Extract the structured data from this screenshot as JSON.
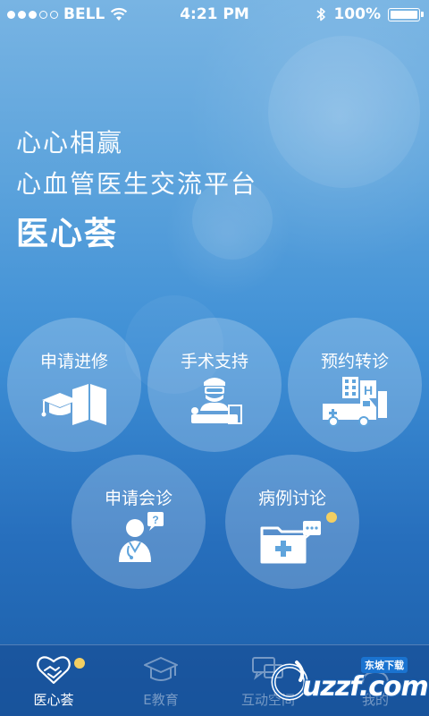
{
  "status_bar": {
    "carrier": "BELL",
    "time": "4:21 PM",
    "battery": "100%"
  },
  "hero": {
    "line1": "心心相赢",
    "line2": "心血管医生交流平台",
    "title": "医心荟"
  },
  "services": [
    {
      "label": "申请进修",
      "icon": "graduation-books-icon"
    },
    {
      "label": "手术支持",
      "icon": "surgeon-operating-icon"
    },
    {
      "label": "预约转诊",
      "icon": "ambulance-hospital-icon"
    },
    {
      "label": "申请会诊",
      "icon": "doctor-question-icon"
    },
    {
      "label": "病例讨论",
      "icon": "medical-folder-chat-icon",
      "has_badge": true
    }
  ],
  "tabs": [
    {
      "label": "医心荟",
      "icon": "heart-handshake-icon",
      "active": true,
      "has_badge": true
    },
    {
      "label": "E教育",
      "icon": "graduation-cap-icon",
      "active": false
    },
    {
      "label": "互动空间",
      "icon": "chat-bubbles-icon",
      "active": false
    },
    {
      "label": "我的",
      "icon": "profile-icon",
      "active": false
    }
  ],
  "watermark": {
    "text": "uzzf.com",
    "tag": "东坡下载"
  },
  "colors": {
    "badge": "#f3cf62",
    "background_top": "#78b4e3",
    "background_bottom": "#1b5ea8"
  }
}
